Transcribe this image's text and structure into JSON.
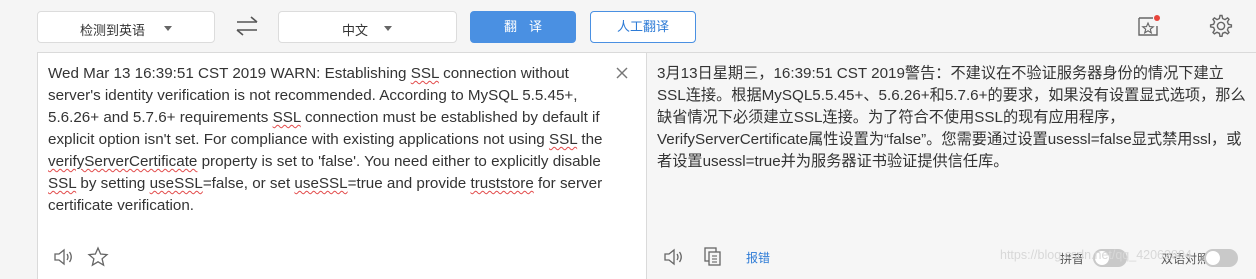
{
  "toolbar": {
    "source_language": "检测到英语",
    "target_language": "中文",
    "translate_button": "翻译",
    "human_translation_button": "人工翻译"
  },
  "source": {
    "segments": [
      {
        "text": "Wed Mar 13 16:39:51 CST 2019 WARN: Establishing ",
        "flag": false
      },
      {
        "text": "SSL",
        "flag": true
      },
      {
        "text": " connection without server's identity verification is not recommended. According to MySQL 5.5.45+, 5.6.26+ and 5.7.6+ requirements ",
        "flag": false
      },
      {
        "text": "SSL",
        "flag": true
      },
      {
        "text": " connection must be established by default if explicit option isn't set. For compliance with existing applications not using ",
        "flag": false
      },
      {
        "text": "SSL",
        "flag": true
      },
      {
        "text": " the ",
        "flag": false
      },
      {
        "text": "verifyServerCertificate",
        "flag": true
      },
      {
        "text": " property is set to 'false'. You need either to explicitly disable ",
        "flag": false
      },
      {
        "text": "SSL",
        "flag": true
      },
      {
        "text": " by setting ",
        "flag": false
      },
      {
        "text": "useSSL",
        "flag": true
      },
      {
        "text": "=false, or set ",
        "flag": false
      },
      {
        "text": "useSSL",
        "flag": true
      },
      {
        "text": "=true and provide ",
        "flag": false
      },
      {
        "text": "truststore",
        "flag": true
      },
      {
        "text": " for server certificate verification.",
        "flag": false
      }
    ]
  },
  "result": {
    "text": "3月13日星期三，16:39:51 CST 2019警告：不建议在不验证服务器身份的情况下建立SSL连接。根据MySQL5.5.45+、5.6.26+和5.7.6+的要求，如果没有设置显式选项，那么缺省情况下必须建立SSL连接。为了符合不使用SSL的现有应用程序，VerifyServerCertificate属性设置为“false”。您需要通过设置usessl=false显式禁用ssl，或者设置usessl=true并为服务器证书验证提供信任库。",
    "report_link": "报错",
    "pinyin_label": "拼音",
    "bilingual_label": "双语对照"
  },
  "watermark": "https://blog.csdn.net/qq_42062804",
  "colors": {
    "primary": "#4a90e2",
    "spellcheck_underline": "#e24b4b",
    "notification_dot": "#e8453c"
  },
  "icons": [
    "swap-icon",
    "new-window-icon",
    "settings-icon",
    "clear-icon",
    "audio-icon",
    "favorite-icon",
    "copy-icon"
  ]
}
